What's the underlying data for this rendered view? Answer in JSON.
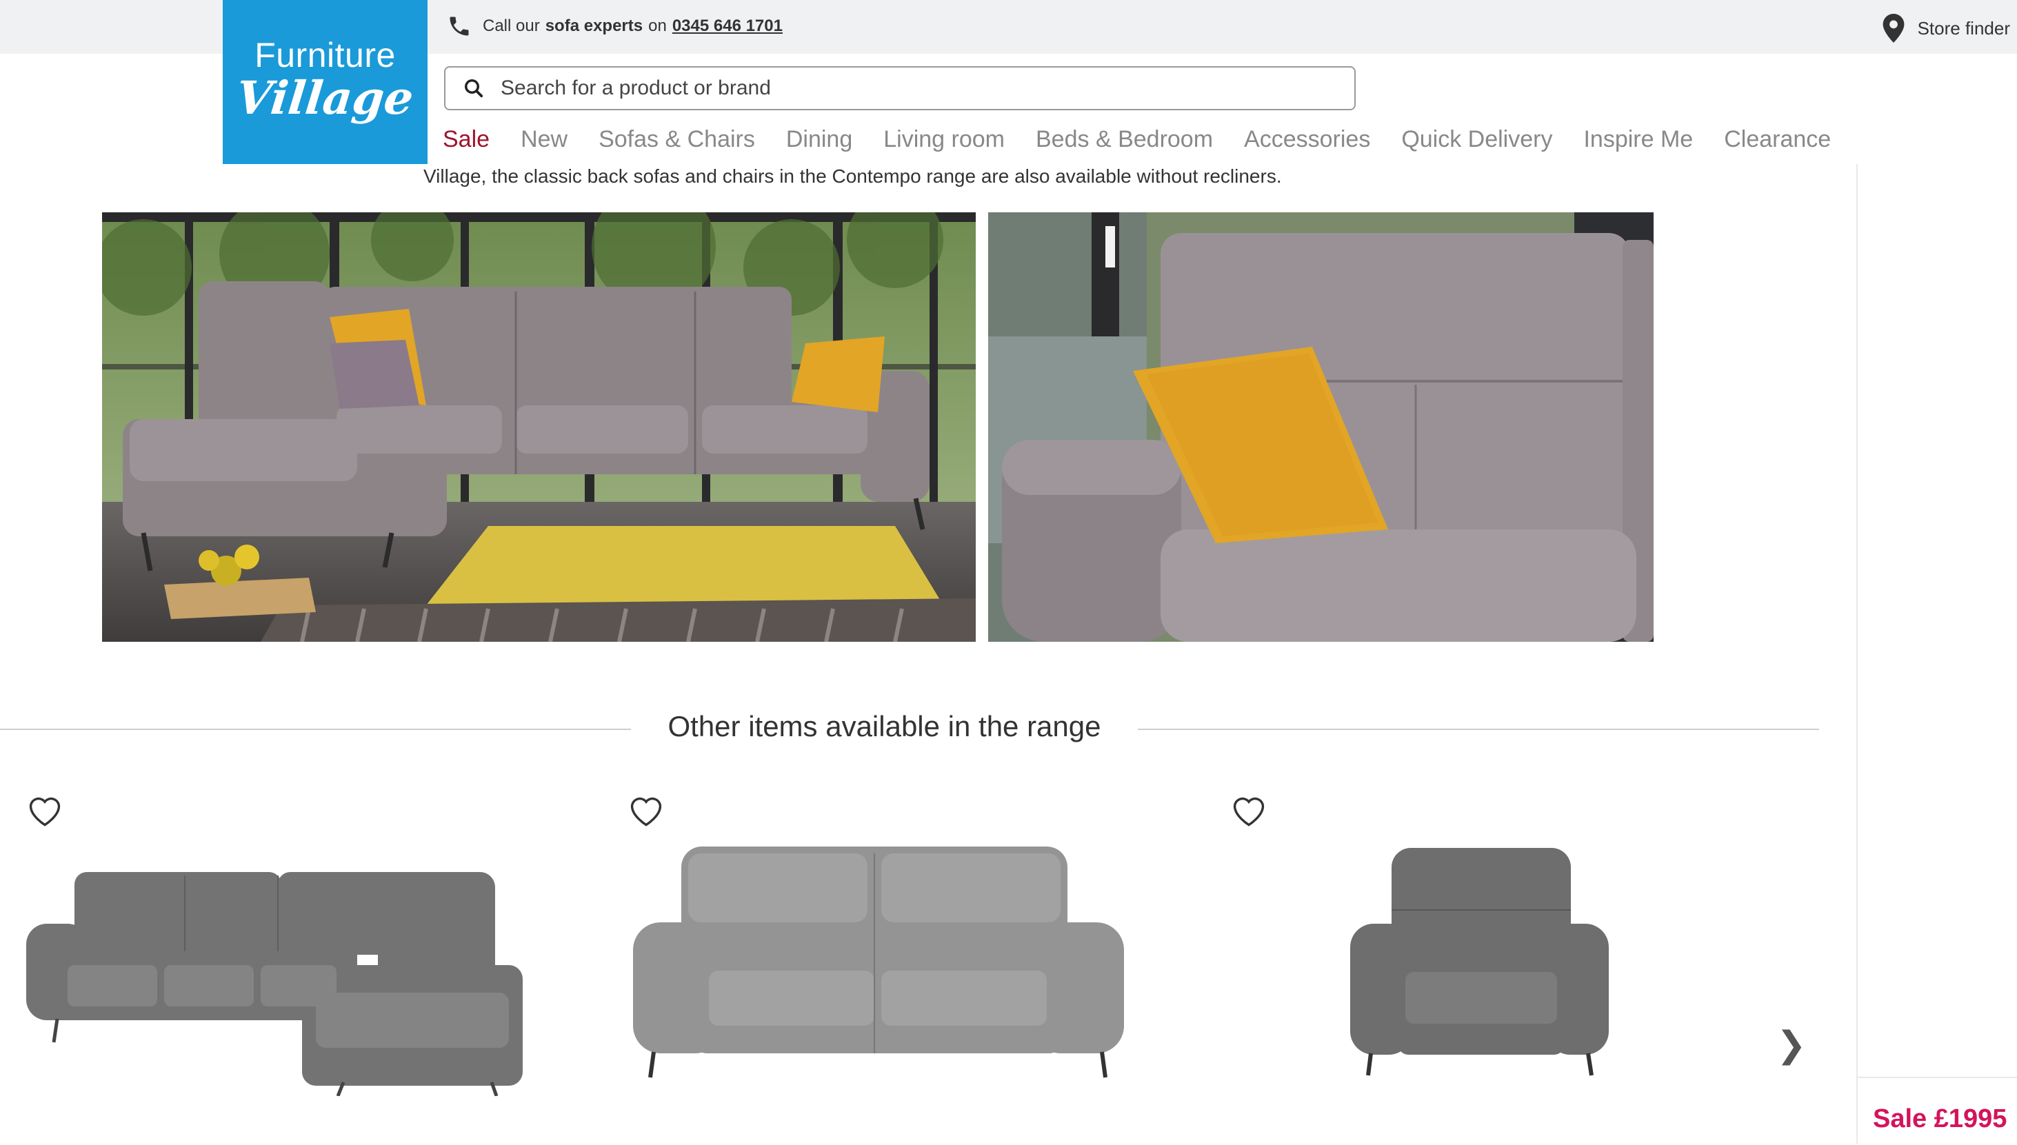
{
  "brand": {
    "line1": "Furniture",
    "line2": "Village"
  },
  "contact": {
    "prefix": "Call our",
    "emphasis": "sofa experts",
    "joiner": "on",
    "phone": "0345 646 1701"
  },
  "store_finder": "Store finder",
  "search": {
    "placeholder": "Search for a product or brand",
    "value": ""
  },
  "nav": [
    {
      "label": "Sale",
      "active": true
    },
    {
      "label": "New"
    },
    {
      "label": "Sofas & Chairs"
    },
    {
      "label": "Dining"
    },
    {
      "label": "Living room"
    },
    {
      "label": "Beds & Bedroom"
    },
    {
      "label": "Accessories"
    },
    {
      "label": "Quick Delivery"
    },
    {
      "label": "Inspire Me"
    },
    {
      "label": "Clearance"
    }
  ],
  "description": "Village, the classic back sofas and chairs in the Contempo range are also available without recliners.",
  "range_heading": "Other items available in the range",
  "products": [
    {
      "kind": "corner-sofa",
      "wishlist_icon": "heart-outline-icon"
    },
    {
      "kind": "three-seater-sofa",
      "wishlist_icon": "heart-outline-icon"
    },
    {
      "kind": "armchair",
      "wishlist_icon": "heart-outline-icon"
    }
  ],
  "carousel_next_icon": "chevron-right-icon",
  "side_price": "Sale £1995",
  "colors": {
    "brand_blue": "#1a9ad9",
    "sale_red": "#a0132b",
    "price_pink": "#d4145a",
    "sofa_grey": "#8d8488",
    "cushion_yellow": "#e2a526"
  }
}
